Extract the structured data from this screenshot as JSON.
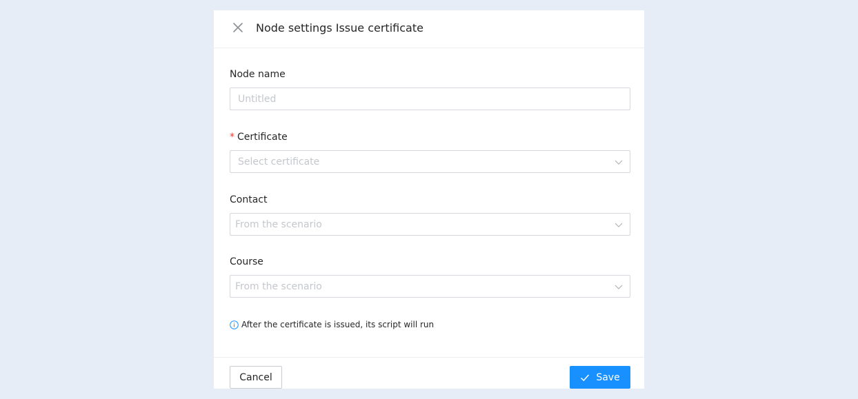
{
  "dialog": {
    "title": "Node settings Issue certificate"
  },
  "form": {
    "node_name": {
      "label": "Node name",
      "placeholder": "Untitled"
    },
    "certificate": {
      "required_mark": "*",
      "label": "Certificate",
      "placeholder": "Select certificate"
    },
    "contact": {
      "label": "Contact",
      "placeholder": "From the scenario"
    },
    "course": {
      "label": "Course",
      "placeholder": "From the scenario"
    }
  },
  "info": {
    "text": "After the certificate is issued, its script will run"
  },
  "footer": {
    "cancel_label": "Cancel",
    "save_label": "Save"
  },
  "colors": {
    "page_background": "#e6edf6",
    "accent": "#1890ff",
    "required": "#e8443a"
  },
  "icons": {
    "close": "close-icon",
    "chevron": "chevron-down-icon",
    "info": "info-icon",
    "check": "check-icon"
  }
}
